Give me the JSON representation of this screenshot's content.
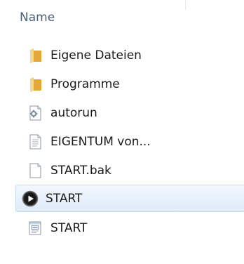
{
  "header": {
    "name_column": "Name"
  },
  "files": [
    {
      "name": "Eigene Dateien",
      "icon": "folder-icon"
    },
    {
      "name": "Programme",
      "icon": "folder-icon"
    },
    {
      "name": "autorun",
      "icon": "settings-file-icon"
    },
    {
      "name": "EIGENTUM von...",
      "icon": "text-file-icon"
    },
    {
      "name": "START.bak",
      "icon": "blank-file-icon"
    },
    {
      "name": "START",
      "icon": "play-icon",
      "selected": true
    },
    {
      "name": "START",
      "icon": "script-file-icon"
    }
  ],
  "colors": {
    "header_text": "#4c607a",
    "selection_top": "#f2f7fd",
    "selection_bottom": "#dfecfa",
    "selection_border": "#c3daf4",
    "folder": "#e8b84a"
  }
}
